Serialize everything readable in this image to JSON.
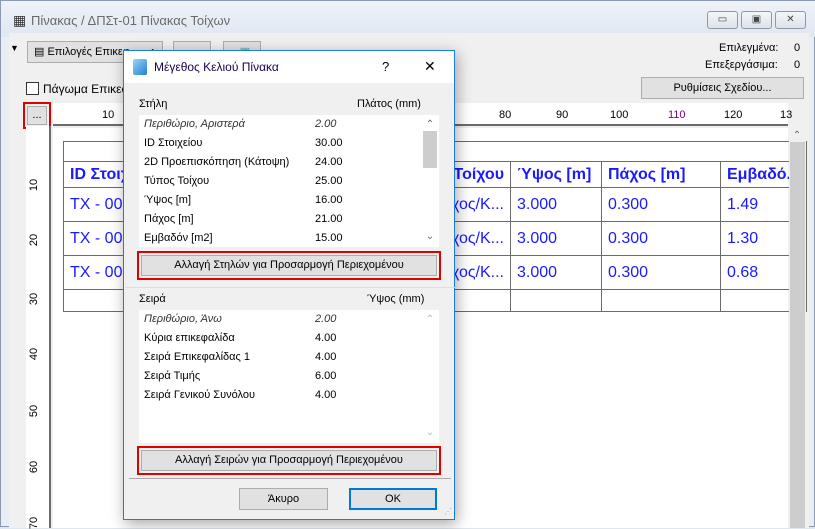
{
  "window": {
    "title": "Πίνακας / ΔΠΣτ-01 Πίνακας Τοίχων",
    "minimize": "▭",
    "restore": "▣",
    "close": "✕"
  },
  "toolbar": {
    "header_options": "Επιλογές Επικεφ",
    "freeze_header": "Πάγωμα Επικεφ",
    "dots_button": "...",
    "design_settings": "Ρυθμίσεις Σχεδίου..."
  },
  "status": {
    "selected_label": "Επιλεγμένα:",
    "selected_value": "0",
    "editable_label": "Επεξεργάσιμα:",
    "editable_value": "0"
  },
  "ruler": {
    "h_ticks": [
      "10",
      "80",
      "90",
      "100",
      "110",
      "120",
      "13"
    ],
    "v_ticks": [
      "10",
      "20",
      "30",
      "40",
      "50",
      "60",
      "70"
    ]
  },
  "table": {
    "headers": [
      "ID Στοιχείου",
      "",
      "Τύπος Τοίχου",
      "Ύψος [m]",
      "Πάχος [m]",
      "Εμβαδό..."
    ],
    "rows": [
      [
        "TX - 001",
        "",
        "Τοίχος/Κ...",
        "3.000",
        "0.300",
        "1.49"
      ],
      [
        "TX - 002",
        "",
        "Τοίχος/Κ...",
        "3.000",
        "0.300",
        "1.30"
      ],
      [
        "TX - 003",
        "",
        "Τοίχος/Κ...",
        "3.000",
        "0.300",
        "0.68"
      ]
    ]
  },
  "dialog": {
    "title": "Μέγεθος Κελιού Πίνακα",
    "help": "?",
    "close": "✕",
    "columns": {
      "label": "Στήλη",
      "unit": "Πλάτος (mm)",
      "items": [
        {
          "name": "Περιθώριο, Αριστερά",
          "value": "2.00"
        },
        {
          "name": "ID Στοιχείου",
          "value": "30.00"
        },
        {
          "name": "2D Προεπισκόπηση (Κάτοψη)",
          "value": "24.00"
        },
        {
          "name": "Τύπος Τοίχου",
          "value": "25.00"
        },
        {
          "name": "Ύψος [m]",
          "value": "16.00"
        },
        {
          "name": "Πάχος [m]",
          "value": "21.00"
        },
        {
          "name": "Εμβαδόν [m2]",
          "value": "15.00"
        }
      ],
      "fit_button": "Αλλαγή Στηλών για Προσαρμογή Περιεχομένου"
    },
    "rows": {
      "label": "Σειρά",
      "unit": "Ύψος (mm)",
      "items": [
        {
          "name": "Περιθώριο, Άνω",
          "value": "2.00"
        },
        {
          "name": "Κύρια επικεφαλίδα",
          "value": "4.00"
        },
        {
          "name": "Σειρά Επικεφαλίδας 1",
          "value": "4.00"
        },
        {
          "name": "Σειρά Τιμής",
          "value": "6.00"
        },
        {
          "name": "Σειρά Γενικού Συνόλου",
          "value": "4.00"
        }
      ],
      "fit_button": "Αλλαγή Σειρών για Προσαρμογή Περιεχομένου"
    },
    "cancel": "Άκυρο",
    "ok": "OK"
  },
  "colors": {
    "accent": "#1c7fd6",
    "highlight": "#e00000",
    "cell_text": "#1a1aff"
  }
}
